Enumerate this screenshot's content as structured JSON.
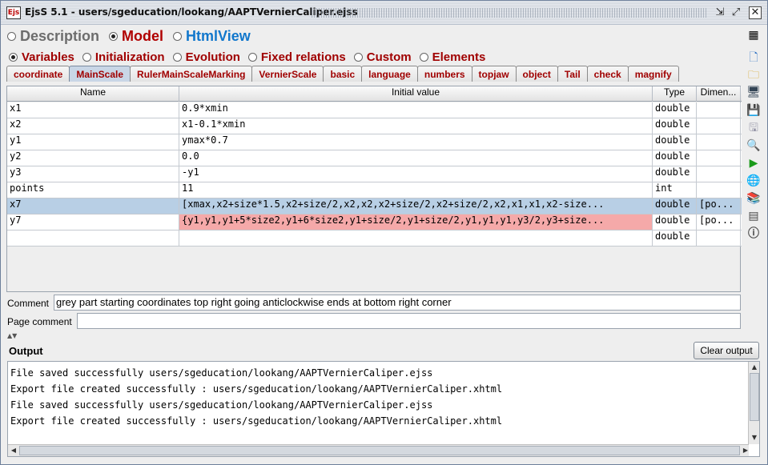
{
  "window": {
    "title": "EjsS 5.1 - users/sgeducation/lookang/AAPTVernierCaliper.ejss",
    "icon_text": "Ejs",
    "controls": [
      "restore-icon",
      "maximize-icon",
      "close-icon"
    ]
  },
  "top_radios": [
    {
      "label": "Description",
      "checked": false
    },
    {
      "label": "Model",
      "checked": true
    },
    {
      "label": "HtmlView",
      "checked": false
    }
  ],
  "sub_radios": [
    {
      "label": "Variables",
      "checked": true
    },
    {
      "label": "Initialization",
      "checked": false
    },
    {
      "label": "Evolution",
      "checked": false
    },
    {
      "label": "Fixed relations",
      "checked": false
    },
    {
      "label": "Custom",
      "checked": false
    },
    {
      "label": "Elements",
      "checked": false
    }
  ],
  "tabs": [
    "coordinate",
    "MainScale",
    "RulerMainScaleMarking",
    "VernierScale",
    "basic",
    "language",
    "numbers",
    "topjaw",
    "object",
    "Tail",
    "check",
    "magnify"
  ],
  "active_tab": "MainScale",
  "table": {
    "headers": [
      "Name",
      "Initial value",
      "Type",
      "Dimen..."
    ],
    "rows": [
      {
        "name": "x1",
        "value": "0.9*xmin",
        "type": "double",
        "dim": ""
      },
      {
        "name": "x2",
        "value": "x1-0.1*xmin",
        "type": "double",
        "dim": ""
      },
      {
        "name": "y1",
        "value": "ymax*0.7",
        "type": "double",
        "dim": ""
      },
      {
        "name": "y2",
        "value": "0.0",
        "type": "double",
        "dim": ""
      },
      {
        "name": "y3",
        "value": "-y1",
        "type": "double",
        "dim": ""
      },
      {
        "name": "points",
        "value": "11",
        "type": "int",
        "dim": ""
      },
      {
        "name": "x7",
        "value": "[xmax,x2+size*1.5,x2+size/2,x2,x2,x2+size/2,x2+size/2,x2,x1,x1,x2-size...",
        "type": "double",
        "dim": "[po..."
      },
      {
        "name": "y7",
        "value": "{y1,y1,y1+5*size2,y1+6*size2,y1+size/2,y1+size/2,y1,y1,y1,y3/2,y3+size...",
        "type": "double",
        "dim": "[po..."
      },
      {
        "name": "",
        "value": "",
        "type": "double",
        "dim": ""
      }
    ]
  },
  "comment": {
    "label": "Comment",
    "value": "grey part starting coordinates top right going anticlockwise ends at bottom right corner"
  },
  "page_comment": {
    "label": "Page comment",
    "value": ""
  },
  "right_toolbar": [
    "new-file-icon",
    "open-folder-icon",
    "open-model-icon",
    "save-icon",
    "save-as-icon",
    "search-icon",
    "run-icon",
    "web-icon",
    "stack-icon",
    "options-icon",
    "info-icon"
  ],
  "output": {
    "title": "Output",
    "clear_label": "Clear output",
    "lines": [
      "File saved successfully users/sgeducation/lookang/AAPTVernierCaliper.ejss",
      "Export file created successfully : users/sgeducation/lookang/AAPTVernierCaliper.xhtml",
      "File saved successfully users/sgeducation/lookang/AAPTVernierCaliper.ejss",
      "Export file created successfully : users/sgeducation/lookang/AAPTVernierCaliper.xhtml"
    ]
  },
  "colors": {
    "model_red": "#b00000",
    "html_blue": "#1177cc",
    "selected_row": "#b8cfe5",
    "error_cell": "#f5a9a9"
  }
}
